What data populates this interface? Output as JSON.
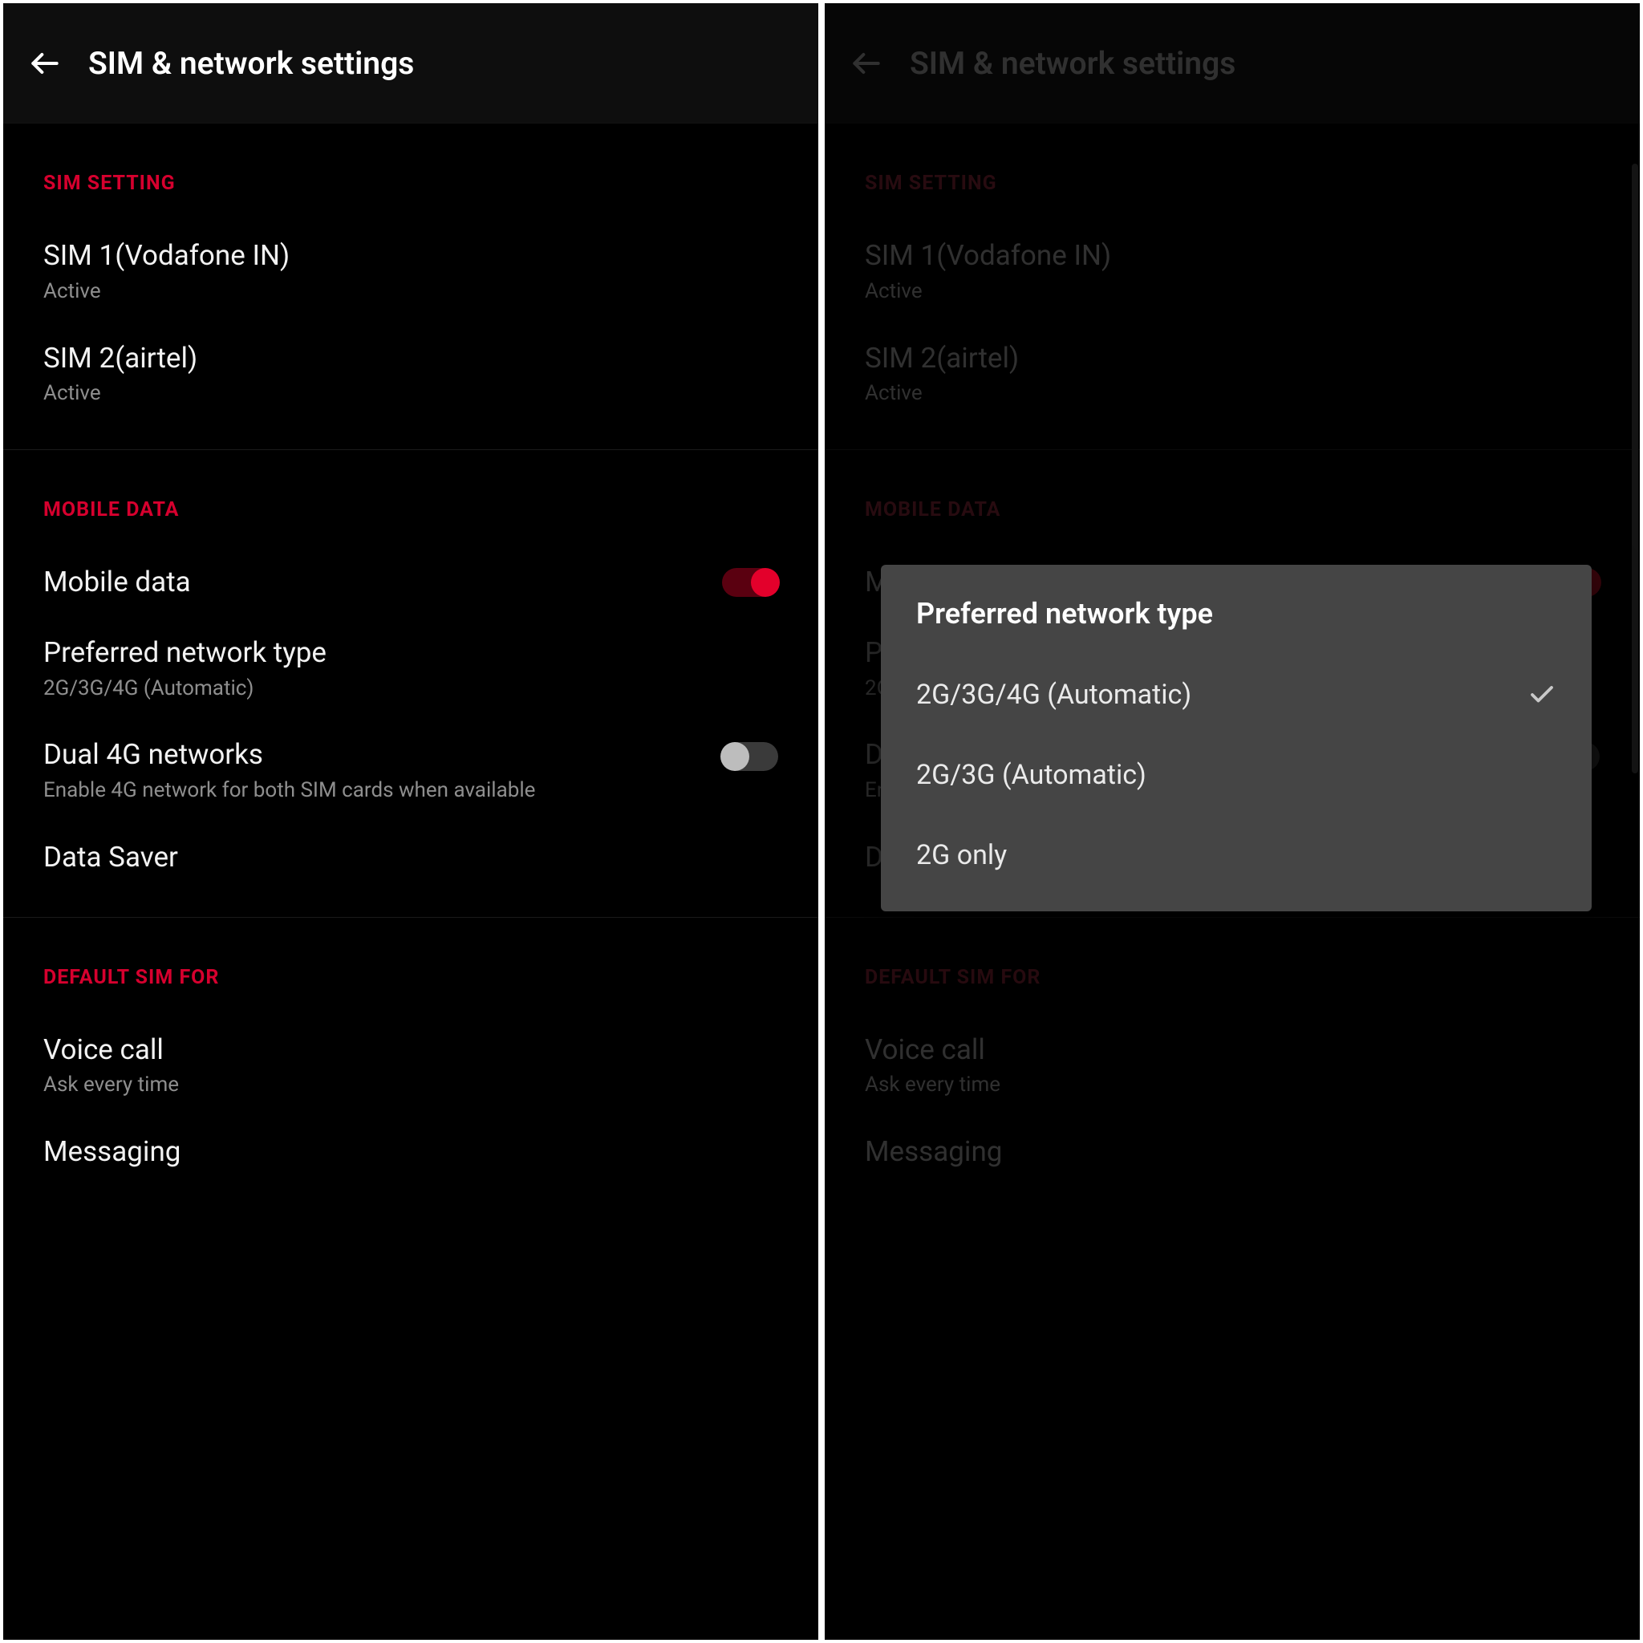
{
  "header": {
    "title": "SIM & network settings"
  },
  "sections": {
    "sim": {
      "header": "SIM SETTING",
      "sim1": {
        "title": "SIM 1(Vodafone IN)",
        "status": "Active"
      },
      "sim2": {
        "title": "SIM 2(airtel)",
        "status": "Active"
      }
    },
    "mobile": {
      "header": "MOBILE DATA",
      "mobile_data": {
        "title": "Mobile data",
        "on": true
      },
      "preferred": {
        "title": "Preferred network type",
        "value": "2G/3G/4G (Automatic)"
      },
      "dual4g": {
        "title": "Dual 4G networks",
        "desc": "Enable 4G network for both SIM cards when available",
        "on": false
      },
      "data_saver": {
        "title": "Data Saver"
      }
    },
    "default_sim": {
      "header": "DEFAULT SIM FOR",
      "voice": {
        "title": "Voice call",
        "value": "Ask every time"
      },
      "messaging": {
        "title": "Messaging"
      }
    }
  },
  "dialog": {
    "title": "Preferred network type",
    "options": [
      {
        "label": "2G/3G/4G (Automatic)",
        "selected": true
      },
      {
        "label": "2G/3G (Automatic)",
        "selected": false
      },
      {
        "label": "2G only",
        "selected": false
      }
    ]
  }
}
